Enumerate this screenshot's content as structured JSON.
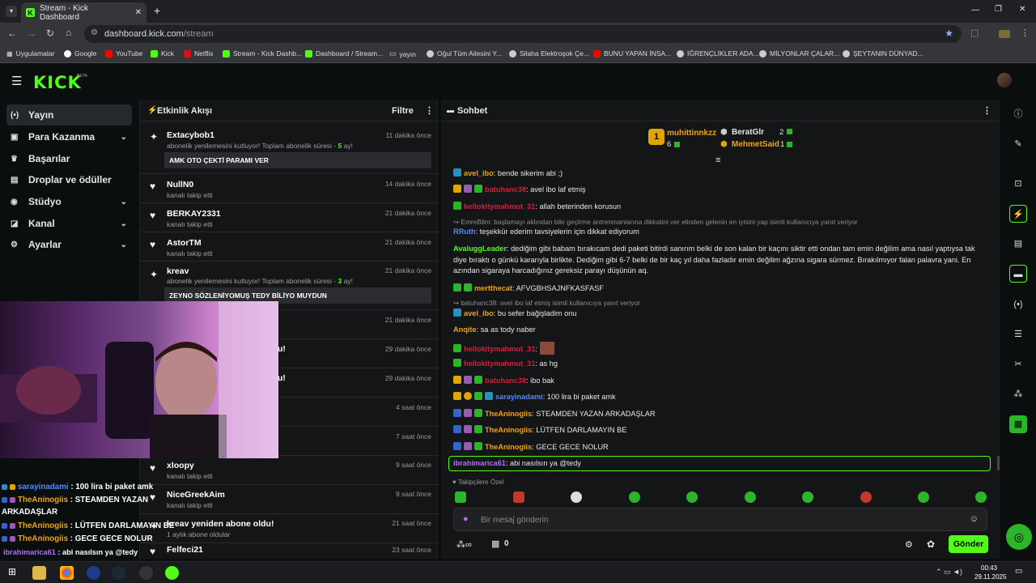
{
  "browser": {
    "tab_title": "Stream - Kick Dashboard",
    "url_host": "dashboard.kick.com",
    "url_path": "/stream",
    "bookmarks": [
      "Uygulamalar",
      "Google",
      "YouTube",
      "Kick",
      "Netflix",
      "Stream - Kick Dashb...",
      "Dashboard / Stream...",
      "yayın",
      "Oğul Tüm Ailesini Y...",
      "Silaha Elektroşok Çe...",
      "BUNU YAPAN İNSA...",
      "İĞRENÇLİKLER ADA...",
      "MİLYONLAR ÇALAR...",
      "ŞEYTANIN DÜNYAD..."
    ]
  },
  "kick": {
    "logo": "KICK",
    "beta": "BETA"
  },
  "sidebar": {
    "items": [
      {
        "label": "Yayın",
        "icon": "broadcast-icon",
        "active": true
      },
      {
        "label": "Para Kazanma",
        "icon": "money-icon",
        "expand": true
      },
      {
        "label": "Başarılar",
        "icon": "trophy-icon"
      },
      {
        "label": "Droplar ve ödüller",
        "icon": "gift-icon"
      },
      {
        "label": "Stüdyo",
        "icon": "studio-icon",
        "expand": true
      },
      {
        "label": "Kanal",
        "icon": "channel-icon",
        "expand": true
      },
      {
        "label": "Ayarlar",
        "icon": "gear-icon",
        "expand": true
      }
    ]
  },
  "activity": {
    "title": "Etkinlik Akışı",
    "filter": "Filtre",
    "items": [
      {
        "name": "Extacybob1",
        "sub": "abonelik yenilemesini kutluyor! Toplam abonelik süresi - ",
        "sub_hl": "5",
        "sub_end": " ay!",
        "time": "11 dakika önce",
        "msg": "AMK OTO ÇEKTİ PARAMI VER",
        "type": "sub"
      },
      {
        "name": "NullN0",
        "sub": "kanalı takip etti",
        "time": "14 dakika önce",
        "type": "follow"
      },
      {
        "name": "BERKAY2331",
        "sub": "kanalı takip etti",
        "time": "21 dakika önce",
        "type": "follow"
      },
      {
        "name": "AstorTM",
        "sub": "kanalı takip etti",
        "time": "21 dakika önce",
        "type": "follow"
      },
      {
        "name": "kreav",
        "sub": "abonelik yenilemesini kutluyor! Toplam abonelik süresi - ",
        "sub_hl": "3",
        "sub_end": " ay!",
        "time": "21 dakika önce",
        "msg": "ZEYNO SÖZLENİYOMUŞ TEDY BİLİYO MUYDUN",
        "type": "sub"
      },
      {
        "time": "21 dakika önce"
      },
      {
        "name": "u!",
        "time": "29 dakika önce"
      },
      {
        "name": "u!",
        "time": "29 dakika önce"
      },
      {
        "time": "4 saat önce"
      },
      {
        "time": "7 saat önce"
      },
      {
        "name": "xloopy",
        "sub": "kanalı takip etti",
        "time": "9 saat önce",
        "type": "follow"
      },
      {
        "name": "NiceGreekAim",
        "sub": "kanalı takip etti",
        "time": "9 saat önce",
        "type": "follow"
      },
      {
        "name": "kreav yeniden abone oldu!",
        "sub": "1 aylık abone oldular",
        "time": "21 saat önce",
        "type": "sub"
      },
      {
        "name": "Felfeci21",
        "time": "23 saat önce",
        "type": "follow"
      }
    ]
  },
  "chat": {
    "title": "Sohbet",
    "leaderboard": {
      "first": "muhittinnkzz",
      "first_count": "6",
      "second": "BeratGlr",
      "second_count": "2",
      "third": "MehmetSaid",
      "third_count": "1",
      "rank": "1"
    },
    "messages": [
      {
        "user": "avel_ibo",
        "color": "#f0a30a",
        "text": ": bende sikerim abi ;)"
      },
      {
        "user": "batuhanc38",
        "color": "#d81b3c",
        "text": ": avel ibo laf etmiş"
      },
      {
        "user": "hellokitymahmut_31",
        "color": "#d81b3c",
        "text": ": allah beterinden korusun"
      },
      {
        "reply": "EmreBilm: başlamayı aklından bile geçirme antrenmanlarına dikkatini ver elinden gelenin en iyisini yap isimli kullanıcıya yanıt veriyor"
      },
      {
        "user": "RRuth",
        "color": "#4a8bff",
        "text": ": teşekkür ederim tavsiyelerin için dikkat ediyorum"
      },
      {
        "user": "AvaluggLeader",
        "color": "#53fc18",
        "text": ": dediğim gibi babam bırakıcam dedi paketi bitirdi sanırım belki de son kalan bir kaçını siktir etti ondan tam emin değilim ama nasıl yaptıysa tak"
      },
      {
        "text": "diye bıraktı o günkü kararıyla birlikte. Dediğim gibi 6-7 belki de bir kaç yıl daha fazladır emin değilim ağzına sigara sürmez. Bırakılmıyor falan palavra yani. En"
      },
      {
        "text": "azından sigaraya harcadığınız gereksiz parayı düşünün aq."
      },
      {
        "user": "mertthecat",
        "color": "#f0a30a",
        "text": ": AFVGBHSAJNFKASFASF"
      },
      {
        "reply": "batuhanc38: avel ibo laf etmiş isimli kullanıcıya yanıt veriyor"
      },
      {
        "user": "avel_ibo",
        "color": "#f0a30a",
        "text": ": bu sefer bağişladim onu"
      },
      {
        "user": "Anqite",
        "color": "#f0a30a",
        "text": ": sa as tody naber"
      },
      {
        "user": "hellokitymahmut_31",
        "color": "#d81b3c",
        "text": ":"
      },
      {
        "user": "hellokitymahmut_31",
        "color": "#d81b3c",
        "text": ": as hg"
      },
      {
        "user": "batuhanc38",
        "color": "#d81b3c",
        "text": ": ibo bak"
      },
      {
        "user": "sarayinadami",
        "color": "#4a8bff",
        "text": ": 100 lira bi paket amk"
      },
      {
        "user": "TheAninogiis",
        "color": "#f0a30a",
        "text": ": STEAMDEN YAZAN ARKADAŞLAR"
      },
      {
        "user": "TheAninogiis",
        "color": "#f0a30a",
        "text": ": LÜTFEN DARLAMAYIN BE"
      },
      {
        "user": "TheAninogiis",
        "color": "#f0a30a",
        "text": ": GECE GECE NOLUR"
      }
    ],
    "selected": {
      "user": "ibrahimarica61",
      "text": ": abi nasılsın ya @tedy"
    },
    "follower_special": "Takipçilere Özel",
    "placeholder": "Bir mesaj gönderin",
    "viewer_count": "0",
    "send": "Gönder"
  },
  "overlay": [
    {
      "user": "sarayinadami",
      "color": "#4a8bff",
      "text": " : 100 lira bi paket amk"
    },
    {
      "user": "TheAninogiis",
      "color": "#f0a30a",
      "text": " : STEAMDEN YAZAN"
    },
    {
      "text": "ARKADAŞLAR"
    },
    {
      "user": "TheAninogiis",
      "color": "#f0a30a",
      "text": " : LÜTFEN DARLAMAYIN BE"
    },
    {
      "user": "TheAninogiis",
      "color": "#f0a30a",
      "text": " : GECE GECE NOLUR"
    },
    {
      "user": "ibrahimarica61",
      "color": "#b36bff",
      "text": " : abi nasılsın ya @tedy"
    }
  ],
  "taskbar": {
    "time": "00:43",
    "date": "29.11.2025"
  },
  "colors": {
    "accent": "#53fc18"
  }
}
